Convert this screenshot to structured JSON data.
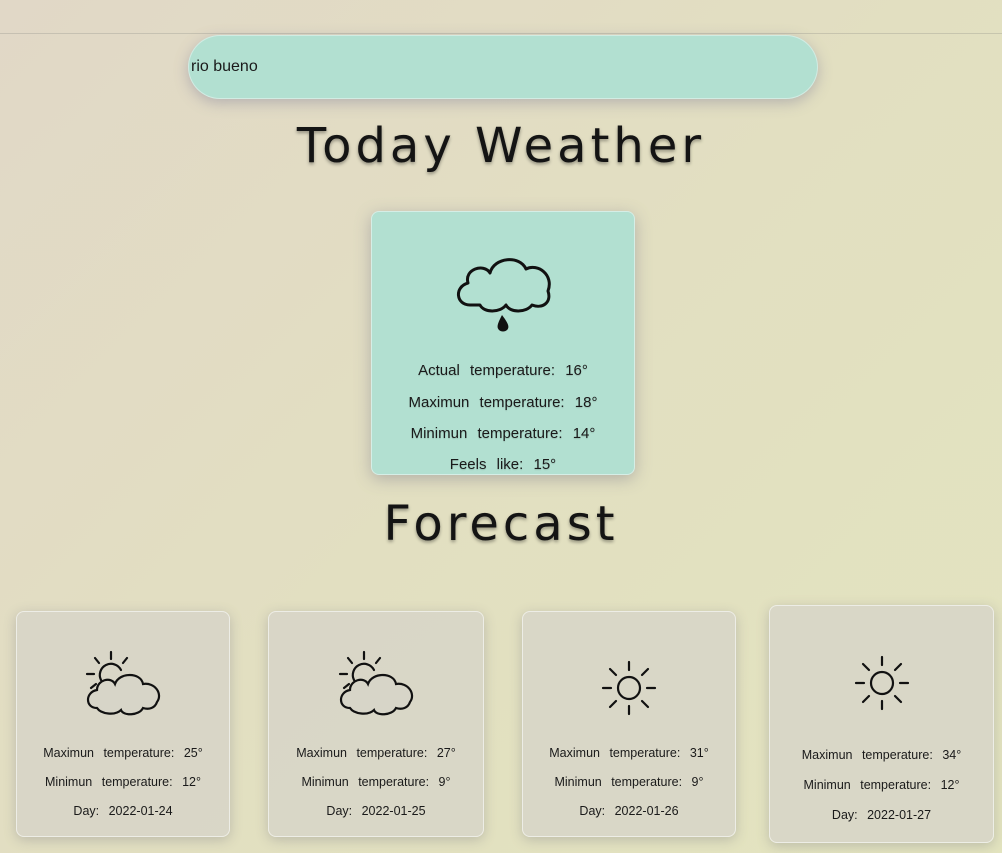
{
  "search": {
    "value": "rio bueno",
    "placeholder": ""
  },
  "today": {
    "title": "Today Weather",
    "icon": "rain-cloud-icon",
    "actual_label": "Actual temperature:",
    "actual_value": "16°",
    "max_label": "Maximun temperature:",
    "max_value": "18°",
    "min_label": "Minimun temperature:",
    "min_value": "14°",
    "feels_label": "Feels like:",
    "feels_value": "15°"
  },
  "forecast": {
    "title": "Forecast",
    "max_label": "Maximun temperature:",
    "min_label": "Minimun temperature:",
    "day_label": "Day:",
    "days": [
      {
        "icon": "partly-cloudy-icon",
        "max": "25°",
        "min": "12°",
        "date": "2022-01-24"
      },
      {
        "icon": "partly-cloudy-icon",
        "max": "27°",
        "min": "9°",
        "date": "2022-01-25"
      },
      {
        "icon": "sun-icon",
        "max": "31°",
        "min": "9°",
        "date": "2022-01-26"
      },
      {
        "icon": "sun-icon",
        "max": "34°",
        "min": "12°",
        "date": "2022-01-27"
      }
    ]
  },
  "colors": {
    "card_accent": "#b2e0d1",
    "forecast_card": "#d7d5c8",
    "text": "#141414"
  }
}
